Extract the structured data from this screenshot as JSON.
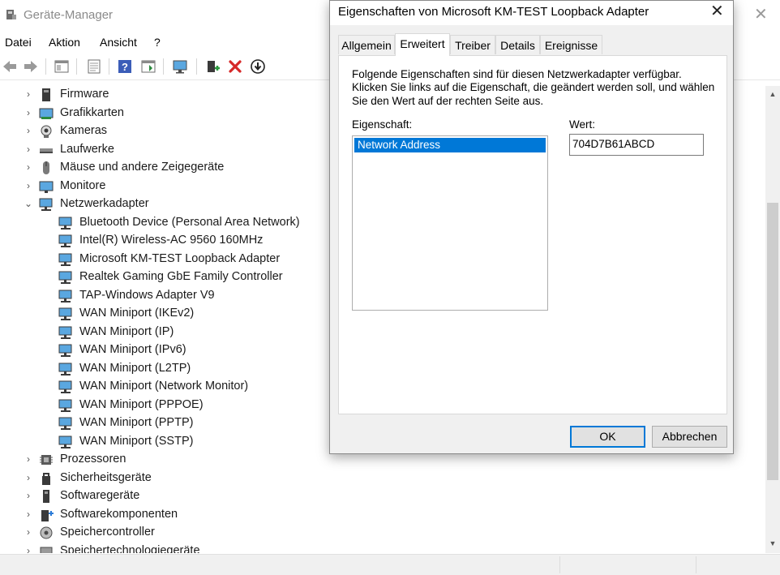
{
  "window": {
    "title": "Geräte-Manager",
    "close_glyph": "✕"
  },
  "menu": [
    "Datei",
    "Aktion",
    "Ansicht",
    "?"
  ],
  "toolbar_icons": [
    "back-arrow-icon",
    "forward-arrow-icon",
    "properties-pane-icon",
    "document-icon",
    "help-icon",
    "update-driver-icon",
    "monitor-scan-icon",
    "add-device-icon",
    "uninstall-x-icon",
    "download-driver-icon"
  ],
  "tree": {
    "items": [
      {
        "label": "Firmware",
        "level": 0,
        "expanded": false,
        "icon": "firmware-icon"
      },
      {
        "label": "Grafikkarten",
        "level": 0,
        "expanded": false,
        "icon": "display-adapter-icon"
      },
      {
        "label": "Kameras",
        "level": 0,
        "expanded": false,
        "icon": "camera-icon"
      },
      {
        "label": "Laufwerke",
        "level": 0,
        "expanded": false,
        "icon": "disk-drive-icon"
      },
      {
        "label": "Mäuse und andere Zeigegeräte",
        "level": 0,
        "expanded": false,
        "icon": "mouse-icon"
      },
      {
        "label": "Monitore",
        "level": 0,
        "expanded": false,
        "icon": "monitor-icon"
      },
      {
        "label": "Netzwerkadapter",
        "level": 0,
        "expanded": true,
        "icon": "network-adapter-icon"
      },
      {
        "label": "Bluetooth Device (Personal Area Network)",
        "level": 1,
        "icon": "network-adapter-icon"
      },
      {
        "label": "Intel(R) Wireless-AC 9560 160MHz",
        "level": 1,
        "icon": "network-adapter-icon"
      },
      {
        "label": "Microsoft KM-TEST Loopback Adapter",
        "level": 1,
        "icon": "network-adapter-icon"
      },
      {
        "label": "Realtek Gaming GbE Family Controller",
        "level": 1,
        "icon": "network-adapter-icon"
      },
      {
        "label": "TAP-Windows Adapter V9",
        "level": 1,
        "icon": "network-adapter-icon"
      },
      {
        "label": "WAN Miniport (IKEv2)",
        "level": 1,
        "icon": "network-adapter-icon"
      },
      {
        "label": "WAN Miniport (IP)",
        "level": 1,
        "icon": "network-adapter-icon"
      },
      {
        "label": "WAN Miniport (IPv6)",
        "level": 1,
        "icon": "network-adapter-icon"
      },
      {
        "label": "WAN Miniport (L2TP)",
        "level": 1,
        "icon": "network-adapter-icon"
      },
      {
        "label": "WAN Miniport (Network Monitor)",
        "level": 1,
        "icon": "network-adapter-icon"
      },
      {
        "label": "WAN Miniport (PPPOE)",
        "level": 1,
        "icon": "network-adapter-icon"
      },
      {
        "label": "WAN Miniport (PPTP)",
        "level": 1,
        "icon": "network-adapter-icon"
      },
      {
        "label": "WAN Miniport (SSTP)",
        "level": 1,
        "icon": "network-adapter-icon"
      },
      {
        "label": "Prozessoren",
        "level": 0,
        "expanded": false,
        "icon": "processor-icon"
      },
      {
        "label": "Sicherheitsgeräte",
        "level": 0,
        "expanded": false,
        "icon": "security-device-icon"
      },
      {
        "label": "Softwaregeräte",
        "level": 0,
        "expanded": false,
        "icon": "software-device-icon"
      },
      {
        "label": "Softwarekomponenten",
        "level": 0,
        "expanded": false,
        "icon": "software-component-icon"
      },
      {
        "label": "Speichercontroller",
        "level": 0,
        "expanded": false,
        "icon": "storage-controller-icon"
      },
      {
        "label": "Speichertechnologiegeräte",
        "level": 0,
        "expanded": false,
        "icon": "storage-technology-icon"
      }
    ]
  },
  "dialog": {
    "title": "Eigenschaften von Microsoft KM-TEST Loopback Adapter",
    "close_glyph": "✕",
    "tabs": [
      {
        "label": "Allgemein",
        "active": false
      },
      {
        "label": "Erweitert",
        "active": true
      },
      {
        "label": "Treiber",
        "active": false
      },
      {
        "label": "Details",
        "active": false
      },
      {
        "label": "Ereignisse",
        "active": false
      }
    ],
    "description": [
      "Folgende Eigenschaften sind für diesen Netzwerkadapter verfügbar.",
      "Klicken Sie links auf die Eigenschaft, die geändert werden soll, und wählen",
      "Sie den Wert auf der rechten Seite aus."
    ],
    "property_label": "Eigenschaft:",
    "value_label": "Wert:",
    "properties": [
      "Network Address"
    ],
    "selected_property": "Network Address",
    "value": "704D7B61ABCD",
    "ok_label": "OK",
    "cancel_label": "Abbrechen",
    "accent_color": "#0078d7"
  }
}
